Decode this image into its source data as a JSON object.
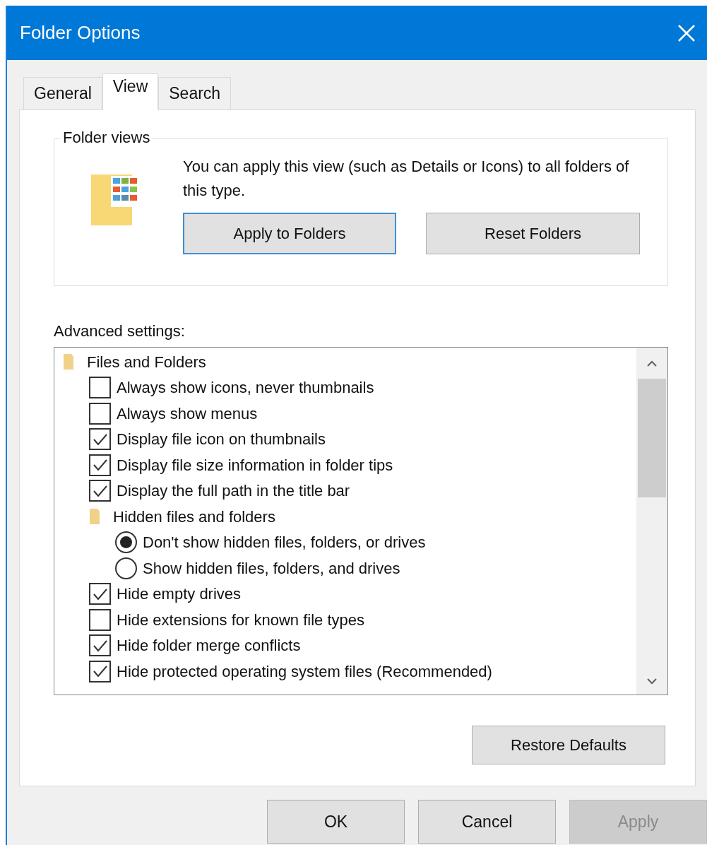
{
  "window": {
    "title": "Folder Options"
  },
  "tabs": [
    {
      "label": "General",
      "selected": false
    },
    {
      "label": "View",
      "selected": true
    },
    {
      "label": "Search",
      "selected": false
    }
  ],
  "folder_views": {
    "title": "Folder views",
    "description": "You can apply this view (such as Details or Icons) to all folders of this type.",
    "buttons": [
      {
        "label": "Apply to Folders",
        "focused": true
      },
      {
        "label": "Reset Folders",
        "focused": false
      }
    ]
  },
  "advanced_settings": {
    "label": "Advanced settings:",
    "items": [
      {
        "kind": "group",
        "label": "Files and Folders",
        "children": [
          {
            "kind": "checkbox",
            "label": "Always show icons, never thumbnails",
            "checked": false
          },
          {
            "kind": "checkbox",
            "label": "Always show menus",
            "checked": false
          },
          {
            "kind": "checkbox",
            "label": "Display file icon on thumbnails",
            "checked": true
          },
          {
            "kind": "checkbox",
            "label": "Display file size information in folder tips",
            "checked": true
          },
          {
            "kind": "checkbox",
            "label": "Display the full path in the title bar",
            "checked": true
          },
          {
            "kind": "group",
            "label": "Hidden files and folders",
            "children": [
              {
                "kind": "radio",
                "label": "Don't show hidden files, folders, or drives",
                "selected": true
              },
              {
                "kind": "radio",
                "label": "Show hidden files, folders, and drives",
                "selected": false
              }
            ]
          },
          {
            "kind": "checkbox",
            "label": "Hide empty drives",
            "checked": true
          },
          {
            "kind": "checkbox",
            "label": "Hide extensions for known file types",
            "checked": false
          },
          {
            "kind": "checkbox",
            "label": "Hide folder merge conflicts",
            "checked": true
          },
          {
            "kind": "checkbox",
            "label": "Hide protected operating system files (Recommended)",
            "checked": true
          }
        ]
      }
    ]
  },
  "restore_button": "Restore Defaults",
  "dialog_buttons": [
    {
      "label": "OK",
      "disabled": false
    },
    {
      "label": "Cancel",
      "disabled": false
    },
    {
      "label": "Apply",
      "disabled": true
    }
  ]
}
